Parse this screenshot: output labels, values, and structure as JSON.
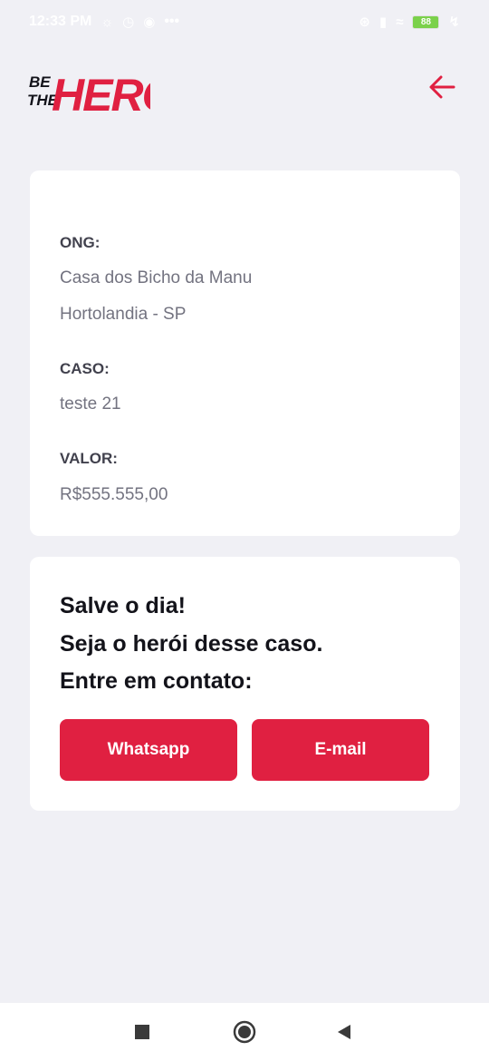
{
  "status_bar": {
    "time": "12:33 PM",
    "more": "•••",
    "battery": "88",
    "icons": [
      "snapchat-icon",
      "alarm-icon",
      "facebook-icon",
      "bluetooth-icon",
      "signal-icon",
      "wifi-icon",
      "battery-icon",
      "charging-icon"
    ]
  },
  "header": {
    "logo_line1": "BE",
    "logo_line2": "THE",
    "logo_word": "HERO",
    "back_icon": "arrow-left-icon"
  },
  "incident": {
    "ong_label": "ONG:",
    "ong_name": "Casa dos Bicho da Manu",
    "ong_location": "Hortolandia - SP",
    "case_label": "CASO:",
    "case_value": "teste 21",
    "value_label": "VALOR:",
    "value_amount": "R$555.555,00"
  },
  "contact": {
    "line1": "Salve o dia!",
    "line2": "Seja o herói desse caso.",
    "line3": "Entre em contato:",
    "whatsapp_label": "Whatsapp",
    "email_label": "E-mail"
  },
  "colors": {
    "accent": "#e02041",
    "background": "#f0f0f5",
    "card": "#ffffff",
    "label": "#41414d",
    "value": "#737380",
    "title": "#13131a"
  },
  "nav_bar": {
    "icons": [
      "recents-square-icon",
      "home-circle-icon",
      "back-triangle-icon"
    ]
  }
}
